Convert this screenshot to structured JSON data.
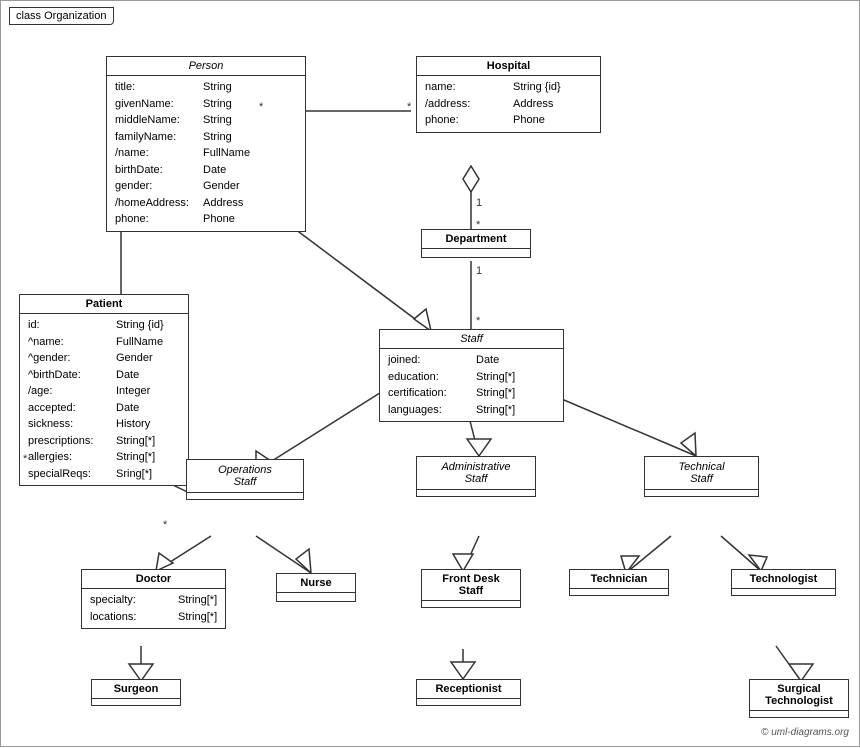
{
  "diagram": {
    "title": "class Organization",
    "copyright": "© uml-diagrams.org",
    "classes": {
      "person": {
        "name": "Person",
        "italic": true,
        "attrs": [
          {
            "name": "title:",
            "type": "String"
          },
          {
            "name": "givenName:",
            "type": "String"
          },
          {
            "name": "middleName:",
            "type": "String"
          },
          {
            "name": "familyName:",
            "type": "String"
          },
          {
            "name": "/name:",
            "type": "FullName"
          },
          {
            "name": "birthDate:",
            "type": "Date"
          },
          {
            "name": "gender:",
            "type": "Gender"
          },
          {
            "name": "/homeAddress:",
            "type": "Address"
          },
          {
            "name": "phone:",
            "type": "Phone"
          }
        ]
      },
      "hospital": {
        "name": "Hospital",
        "attrs": [
          {
            "name": "name:",
            "type": "String {id}"
          },
          {
            "name": "/address:",
            "type": "Address"
          },
          {
            "name": "phone:",
            "type": "Phone"
          }
        ]
      },
      "department": {
        "name": "Department",
        "attrs": []
      },
      "staff": {
        "name": "Staff",
        "italic": true,
        "attrs": [
          {
            "name": "joined:",
            "type": "Date"
          },
          {
            "name": "education:",
            "type": "String[*]"
          },
          {
            "name": "certification:",
            "type": "String[*]"
          },
          {
            "name": "languages:",
            "type": "String[*]"
          }
        ]
      },
      "patient": {
        "name": "Patient",
        "attrs": [
          {
            "name": "id:",
            "type": "String {id}"
          },
          {
            "name": "^name:",
            "type": "FullName"
          },
          {
            "name": "^gender:",
            "type": "Gender"
          },
          {
            "name": "^birthDate:",
            "type": "Date"
          },
          {
            "name": "/age:",
            "type": "Integer"
          },
          {
            "name": "accepted:",
            "type": "Date"
          },
          {
            "name": "sickness:",
            "type": "History"
          },
          {
            "name": "prescriptions:",
            "type": "String[*]"
          },
          {
            "name": "allergies:",
            "type": "String[*]"
          },
          {
            "name": "specialReqs:",
            "type": "Sring[*]"
          }
        ]
      },
      "operations_staff": {
        "name": "Operations Staff",
        "italic": true
      },
      "administrative_staff": {
        "name": "Administrative Staff",
        "italic": true
      },
      "technical_staff": {
        "name": "Technical Staff",
        "italic": true
      },
      "doctor": {
        "name": "Doctor",
        "attrs": [
          {
            "name": "specialty:",
            "type": "String[*]"
          },
          {
            "name": "locations:",
            "type": "String[*]"
          }
        ]
      },
      "nurse": {
        "name": "Nurse",
        "attrs": []
      },
      "front_desk_staff": {
        "name": "Front Desk Staff",
        "attrs": []
      },
      "technician": {
        "name": "Technician",
        "attrs": []
      },
      "technologist": {
        "name": "Technologist",
        "attrs": []
      },
      "surgeon": {
        "name": "Surgeon",
        "attrs": []
      },
      "receptionist": {
        "name": "Receptionist",
        "attrs": []
      },
      "surgical_technologist": {
        "name": "Surgical Technologist",
        "attrs": []
      }
    }
  }
}
